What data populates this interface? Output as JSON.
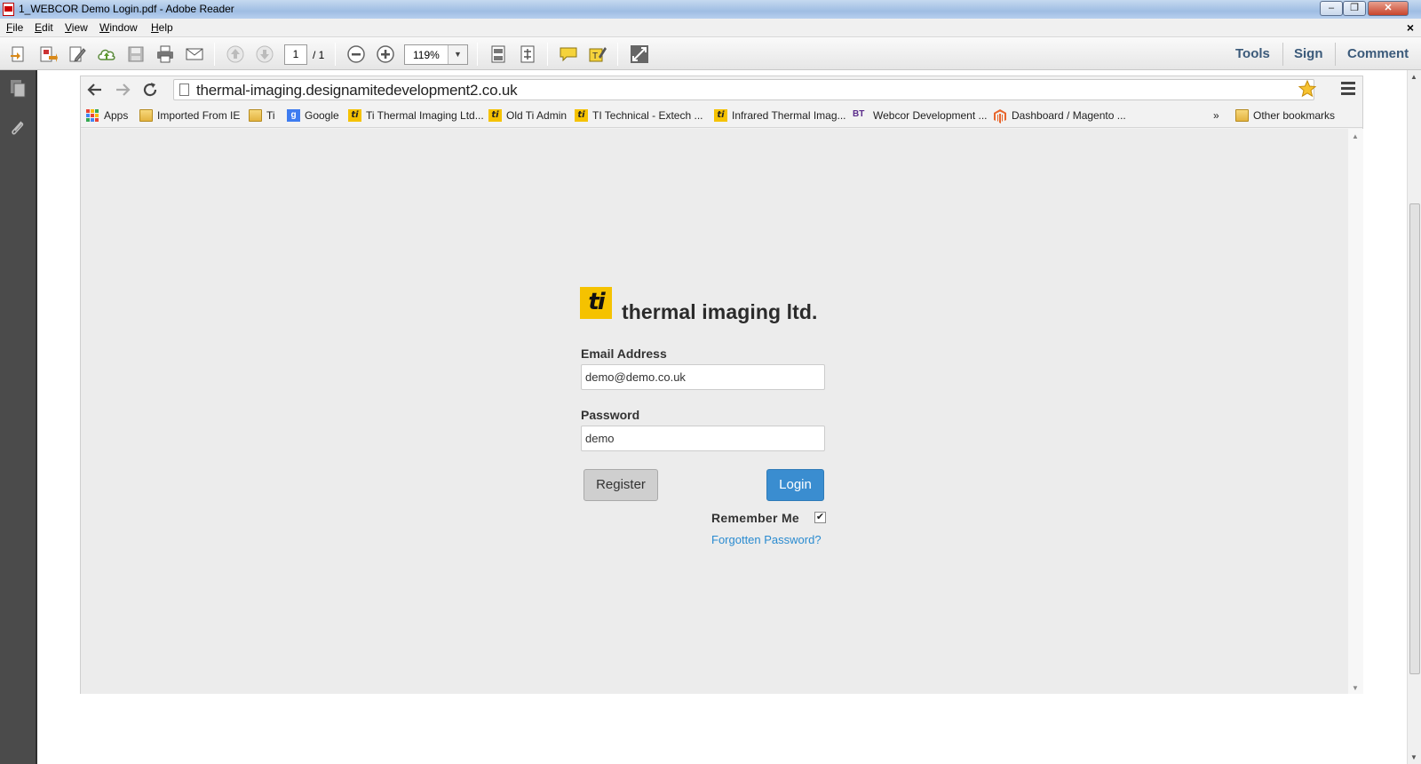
{
  "window": {
    "title": "1_WEBCOR Demo Login.pdf - Adobe Reader",
    "minimize": "‒",
    "restore": "❐",
    "close": "✕"
  },
  "menu": {
    "items": [
      "File",
      "Edit",
      "View",
      "Window",
      "Help"
    ],
    "close": "×"
  },
  "toolbar": {
    "page_current": "1",
    "page_total": "/ 1",
    "zoom": "119%",
    "right": [
      "Tools",
      "Sign",
      "Comment"
    ]
  },
  "browser": {
    "url": "thermal-imaging.designamitedevelopment2.co.uk",
    "bookmarks": [
      {
        "label": "Apps",
        "icon": "apps-grid"
      },
      {
        "label": "Imported From IE",
        "icon": "folder"
      },
      {
        "label": "Ti",
        "icon": "folder"
      },
      {
        "label": "Google",
        "icon": "google"
      },
      {
        "label": "Ti Thermal Imaging Ltd...",
        "icon": "ti-logo"
      },
      {
        "label": "Old Ti Admin",
        "icon": "ti-logo"
      },
      {
        "label": "TI Technical - Extech ...",
        "icon": "ti-logo"
      },
      {
        "label": "Infrared Thermal Imag...",
        "icon": "ti-logo"
      },
      {
        "label": "Webcor Development ...",
        "icon": "bt-logo"
      },
      {
        "label": "Dashboard / Magento ...",
        "icon": "magento-logo"
      }
    ],
    "overflow": "»",
    "other_bookmarks": "Other bookmarks"
  },
  "login": {
    "logo_mark": "ti",
    "brand": "thermal imaging ltd.",
    "email_label": "Email Address",
    "email_value": "demo@demo.co.uk",
    "password_label": "Password",
    "password_value": "demo",
    "register": "Register",
    "login": "Login",
    "remember": "Remember Me",
    "remember_checked": "✔",
    "forgot": "Forgotten Password?"
  },
  "colors": {
    "login_button": "#3a8dd0",
    "link": "#2a8bd0",
    "brand_yellow": "#f5c200"
  }
}
